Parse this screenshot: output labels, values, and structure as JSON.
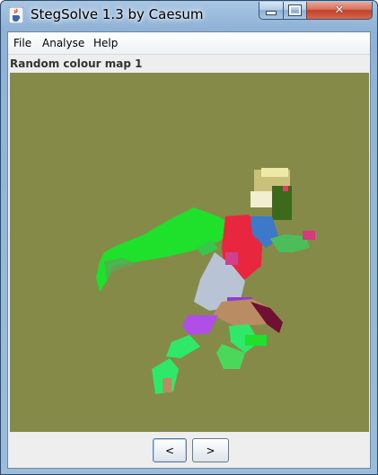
{
  "window": {
    "title": "StegSolve 1.3 by Caesum",
    "controls": {
      "minimize": "minimize-icon",
      "maximize": "maximize-icon",
      "close": "close-icon"
    }
  },
  "menu": {
    "items": [
      {
        "label": "File"
      },
      {
        "label": "Analyse"
      },
      {
        "label": "Help"
      }
    ]
  },
  "view": {
    "label": "Random colour map 1",
    "background": "#858a49"
  },
  "nav": {
    "prev_label": "<",
    "next_label": ">"
  }
}
